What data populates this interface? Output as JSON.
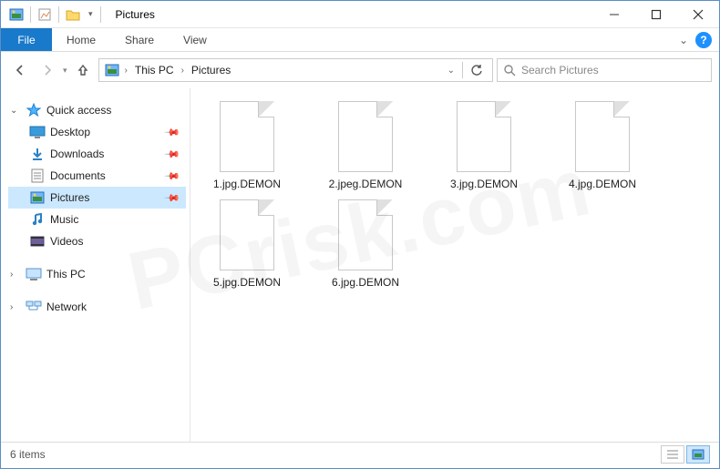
{
  "title": "Pictures",
  "ribbon": {
    "file": "File",
    "tabs": [
      "Home",
      "Share",
      "View"
    ]
  },
  "breadcrumb": [
    "This PC",
    "Pictures"
  ],
  "search": {
    "placeholder": "Search Pictures"
  },
  "sidebar": {
    "quick_access": "Quick access",
    "items": [
      {
        "label": "Desktop",
        "icon": "desktop"
      },
      {
        "label": "Downloads",
        "icon": "downloads"
      },
      {
        "label": "Documents",
        "icon": "documents"
      },
      {
        "label": "Pictures",
        "icon": "pictures",
        "selected": true
      },
      {
        "label": "Music",
        "icon": "music"
      },
      {
        "label": "Videos",
        "icon": "videos"
      }
    ],
    "this_pc": "This PC",
    "network": "Network"
  },
  "files": [
    "1.jpg.DEMON",
    "2.jpeg.DEMON",
    "3.jpg.DEMON",
    "4.jpg.DEMON",
    "5.jpg.DEMON",
    "6.jpg.DEMON"
  ],
  "status": "6 items",
  "watermark": "PCrisk.com"
}
